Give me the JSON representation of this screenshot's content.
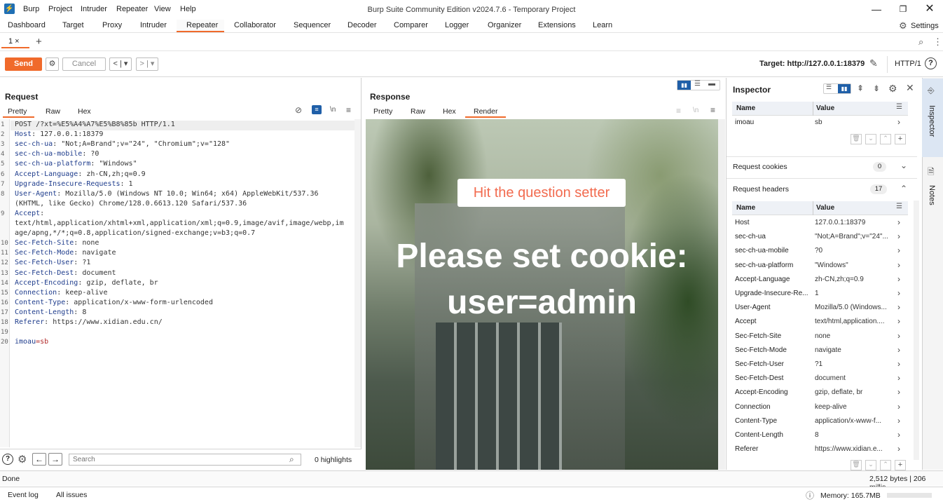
{
  "window": {
    "title": "Burp Suite Community Edition v2024.7.6 - Temporary Project",
    "menu": [
      "Burp",
      "Project",
      "Intruder",
      "Repeater",
      "View",
      "Help"
    ]
  },
  "main_tabs": [
    "Dashboard",
    "Target",
    "Proxy",
    "Intruder",
    "Repeater",
    "Collaborator",
    "Sequencer",
    "Decoder",
    "Comparer",
    "Logger",
    "Organizer",
    "Extensions",
    "Learn"
  ],
  "settings_label": "Settings",
  "repeater_tabs": [
    {
      "label": "1 ×"
    }
  ],
  "add_tab": "+",
  "toolbar": {
    "send": "Send",
    "cancel": "Cancel",
    "target": "Target: http://127.0.0.1:18379",
    "http_version": "HTTP/1"
  },
  "request": {
    "title": "Request",
    "tabs": [
      "Pretty",
      "Raw",
      "Hex"
    ],
    "active_tab": "Pretty",
    "lines": [
      {
        "n": "1",
        "name": "",
        "value": "POST /?xt=%E5%A4%A7%E5%B8%85b HTTP/1.1"
      },
      {
        "n": "2",
        "name": "Host",
        "value": ":  127.0.0.1:18379"
      },
      {
        "n": "3",
        "name": "sec-ch-ua",
        "value": ":  \"Not;A=Brand\";v=\"24\",  \"Chromium\";v=\"128\""
      },
      {
        "n": "4",
        "name": "sec-ch-ua-mobile",
        "value": ":  ?0"
      },
      {
        "n": "5",
        "name": "sec-ch-ua-platform",
        "value": ":  \"Windows\""
      },
      {
        "n": "6",
        "name": "Accept-Language",
        "value": ":  zh-CN,zh;q=0.9"
      },
      {
        "n": "7",
        "name": "Upgrade-Insecure-Requests",
        "value": ":  1"
      },
      {
        "n": "8",
        "name": "User-Agent",
        "value": ":  Mozilla/5.0 (Windows NT 10.0; Win64; x64) AppleWebKit/537.36"
      },
      {
        "n": "",
        "name": "",
        "value": "(KHTML, like Gecko) Chrome/128.0.6613.120 Safari/537.36"
      },
      {
        "n": "9",
        "name": "Accept",
        "value": ":"
      },
      {
        "n": "",
        "name": "",
        "value": "text/html,application/xhtml+xml,application/xml;q=0.9,image/avif,image/webp,im"
      },
      {
        "n": "",
        "name": "",
        "value": "age/apng,*/*;q=0.8,application/signed-exchange;v=b3;q=0.7"
      },
      {
        "n": "10",
        "name": "Sec-Fetch-Site",
        "value": ":  none"
      },
      {
        "n": "11",
        "name": "Sec-Fetch-Mode",
        "value": ":  navigate"
      },
      {
        "n": "12",
        "name": "Sec-Fetch-User",
        "value": ":  ?1"
      },
      {
        "n": "13",
        "name": "Sec-Fetch-Dest",
        "value": ":  document"
      },
      {
        "n": "14",
        "name": "Accept-Encoding",
        "value": ":  gzip, deflate, br"
      },
      {
        "n": "15",
        "name": "Connection",
        "value": ":  keep-alive"
      },
      {
        "n": "16",
        "name": "Content-Type",
        "value": ":  application/x-www-form-urlencoded"
      },
      {
        "n": "17",
        "name": "Content-Length",
        "value": ":  8"
      },
      {
        "n": "18",
        "name": "Referer",
        "value": ":  https://www.xidian.edu.cn/"
      },
      {
        "n": "19",
        "name": "",
        "value": ""
      },
      {
        "n": "20",
        "name": "imoau",
        "value": "=sb"
      }
    ],
    "search_placeholder": "Search",
    "highlights": "0 highlights"
  },
  "response": {
    "title": "Response",
    "tabs": [
      "Pretty",
      "Raw",
      "Hex",
      "Render"
    ],
    "active_tab": "Render",
    "render_button": "Hit the question setter",
    "render_heading_1": "Please set cookie:",
    "render_heading_2": "user=admin"
  },
  "inspector": {
    "title": "Inspector",
    "col_name": "Name",
    "col_value": "Value",
    "query_params": [
      {
        "name": "imoau",
        "value": "sb"
      }
    ],
    "cookies_label": "Request cookies",
    "cookies_count": "0",
    "headers_label": "Request headers",
    "headers_count": "17",
    "headers": [
      {
        "name": "Host",
        "value": "127.0.0.1:18379"
      },
      {
        "name": "sec-ch-ua",
        "value": "\"Not;A=Brand\";v=\"24\"..."
      },
      {
        "name": "sec-ch-ua-mobile",
        "value": "?0"
      },
      {
        "name": "sec-ch-ua-platform",
        "value": "\"Windows\""
      },
      {
        "name": "Accept-Language",
        "value": "zh-CN,zh;q=0.9"
      },
      {
        "name": "Upgrade-Insecure-Re...",
        "value": "1"
      },
      {
        "name": "User-Agent",
        "value": "Mozilla/5.0 (Windows..."
      },
      {
        "name": "Accept",
        "value": "text/html,application...."
      },
      {
        "name": "Sec-Fetch-Site",
        "value": "none"
      },
      {
        "name": "Sec-Fetch-Mode",
        "value": "navigate"
      },
      {
        "name": "Sec-Fetch-User",
        "value": "?1"
      },
      {
        "name": "Sec-Fetch-Dest",
        "value": "document"
      },
      {
        "name": "Accept-Encoding",
        "value": "gzip, deflate, br"
      },
      {
        "name": "Connection",
        "value": "keep-alive"
      },
      {
        "name": "Content-Type",
        "value": "application/x-www-f..."
      },
      {
        "name": "Content-Length",
        "value": "8"
      },
      {
        "name": "Referer",
        "value": "https://www.xidian.e..."
      }
    ]
  },
  "side_tabs": [
    "Inspector",
    "Notes"
  ],
  "status": {
    "left": "Done",
    "right": "2,512 bytes | 206 millis",
    "event_log": "Event log",
    "all_issues": "All issues",
    "memory": "Memory: 165.7MB"
  },
  "colors": {
    "accent": "#f06a2b",
    "header_name": "#1e3c8c",
    "selected": "#1f5fa8"
  }
}
